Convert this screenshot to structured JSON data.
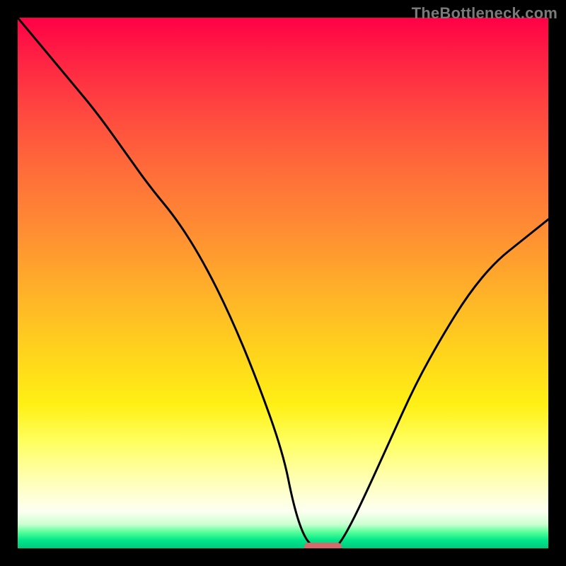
{
  "watermark": "TheBottleneck.com",
  "colors": {
    "frame_border": "#000000",
    "curve": "#000000",
    "marker": "#d46a6a",
    "watermark": "#7a7a7a"
  },
  "chart_data": {
    "type": "line",
    "title": "",
    "xlabel": "",
    "ylabel": "",
    "xlim": [
      0,
      100
    ],
    "ylim": [
      0,
      100
    ],
    "grid": false,
    "series": [
      {
        "name": "bottleneck-curve",
        "x": [
          0,
          5,
          10,
          15,
          20,
          25,
          30,
          35,
          40,
          45,
          50,
          52,
          54,
          56,
          58,
          60,
          62,
          65,
          70,
          75,
          80,
          85,
          90,
          95,
          100
        ],
        "y": [
          100,
          94,
          88,
          82,
          75,
          68,
          62,
          54,
          44,
          32,
          18,
          8,
          2,
          0,
          0,
          0,
          3,
          9,
          20,
          31,
          40,
          48,
          54,
          58,
          62
        ]
      }
    ],
    "marker": {
      "x_start": 54,
      "x_end": 61,
      "y": 0
    }
  }
}
